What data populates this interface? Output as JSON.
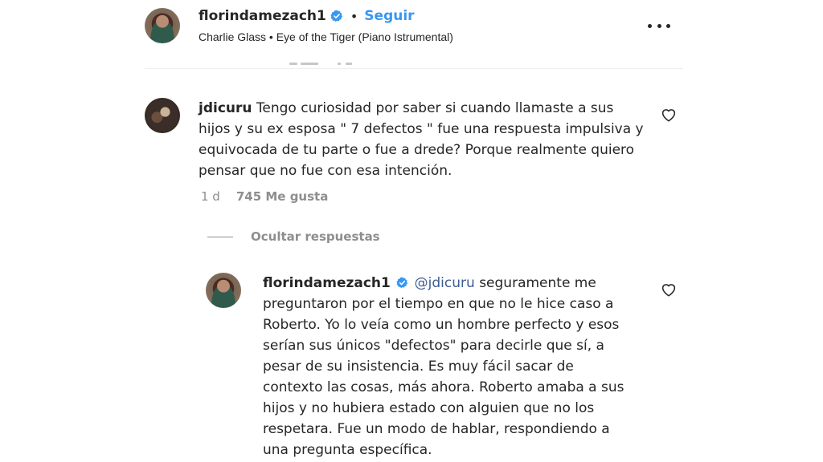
{
  "post": {
    "author": "florindamezach1",
    "separator": "•",
    "follow_label": "Seguir",
    "music": "Charlie Glass • Eye of the Tiger (Piano Istrumental)"
  },
  "comments": [
    {
      "username": "jdicuru",
      "text": "Tengo curiosidad por saber si cuando llamaste a sus hijos y su ex esposa \" 7 defectos \" fue una respuesta impulsiva y equivocada de tu parte o fue a drede? Porque realmente quiero pensar que no fue con esa intención.",
      "time": "1 d",
      "likes": "745 Me gusta"
    }
  ],
  "replies_toggle": "Ocultar respuestas",
  "reply": {
    "username": "florindamezach1",
    "mention": "@jdicuru",
    "text": " seguramente me preguntaron por el tiempo en que no le hice caso a Roberto. Yo lo veía como un hombre perfecto y esos serían sus únicos \"defectos\" para decirle que sí, a pesar de su insistencia. Es muy fácil sacar de contexto las cosas, más ahora. Roberto amaba a sus hijos y no hubiera estado con alguien que no los respetara. Fue un modo de hablar, respondiendo a una pregunta específica."
  },
  "icons": {
    "verified": "verified-badge-icon",
    "heart": "heart-outline-icon",
    "more": "more-options-icon"
  },
  "colors": {
    "link": "#3897f0",
    "mention": "#3c5b92",
    "muted": "#8e8e8e"
  }
}
